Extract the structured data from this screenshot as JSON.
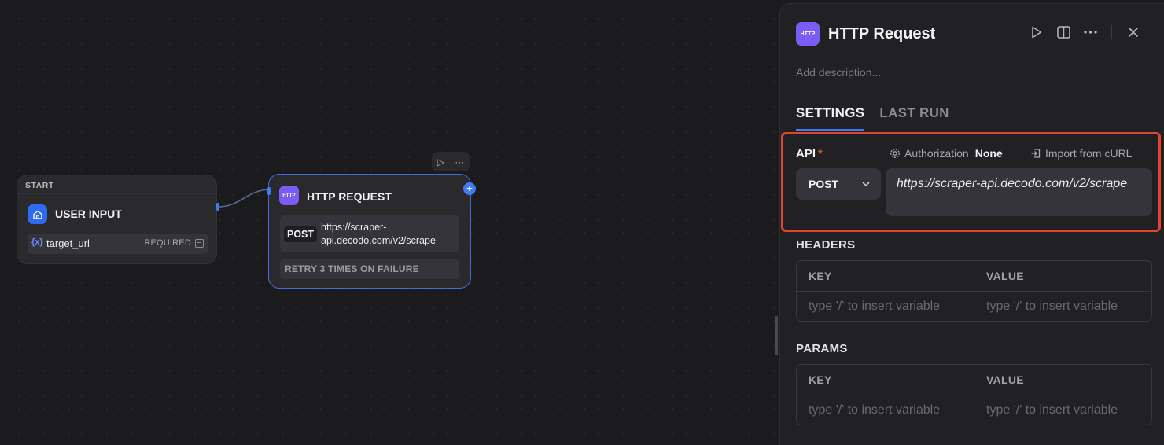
{
  "canvas": {
    "start_node": {
      "header": "START",
      "title": "USER INPUT",
      "variable": {
        "name": "target_url",
        "badge": "REQUIRED"
      },
      "icon": "home-icon"
    },
    "http_node": {
      "title": "HTTP REQUEST",
      "icon_text": "HTTP",
      "method": "POST",
      "url": "https://scraper-api.decodo.com/v2/scrape",
      "retry": "RETRY 3 TIMES ON FAILURE",
      "add_label": "+"
    },
    "mini_toolbar": {
      "run_icon": "▷",
      "more_icon": "···"
    }
  },
  "panel": {
    "icon_text": "HTTP",
    "title": "HTTP Request",
    "description_placeholder": "Add description...",
    "tabs": [
      {
        "label": "SETTINGS",
        "active": true
      },
      {
        "label": "LAST RUN",
        "active": false
      }
    ],
    "api": {
      "label": "API",
      "required_mark": "*",
      "authorization_label": "Authorization",
      "authorization_value": "None",
      "import_label": "Import from cURL",
      "method": "POST",
      "url": "https://scraper-api.decodo.com/v2/scrape"
    },
    "headers": {
      "title": "HEADERS",
      "key_header": "KEY",
      "value_header": "VALUE",
      "key_placeholder": "type '/' to insert variable",
      "value_placeholder": "type '/' to insert variable"
    },
    "params": {
      "title": "PARAMS",
      "key_header": "KEY",
      "value_header": "VALUE",
      "key_placeholder": "type '/' to insert variable",
      "value_placeholder": "type '/' to insert variable"
    }
  },
  "colors": {
    "accent_blue": "#3f7bf4",
    "http_purple": "#7b5cf5",
    "highlight_red": "#e2452f",
    "required_red": "#e0533d"
  }
}
